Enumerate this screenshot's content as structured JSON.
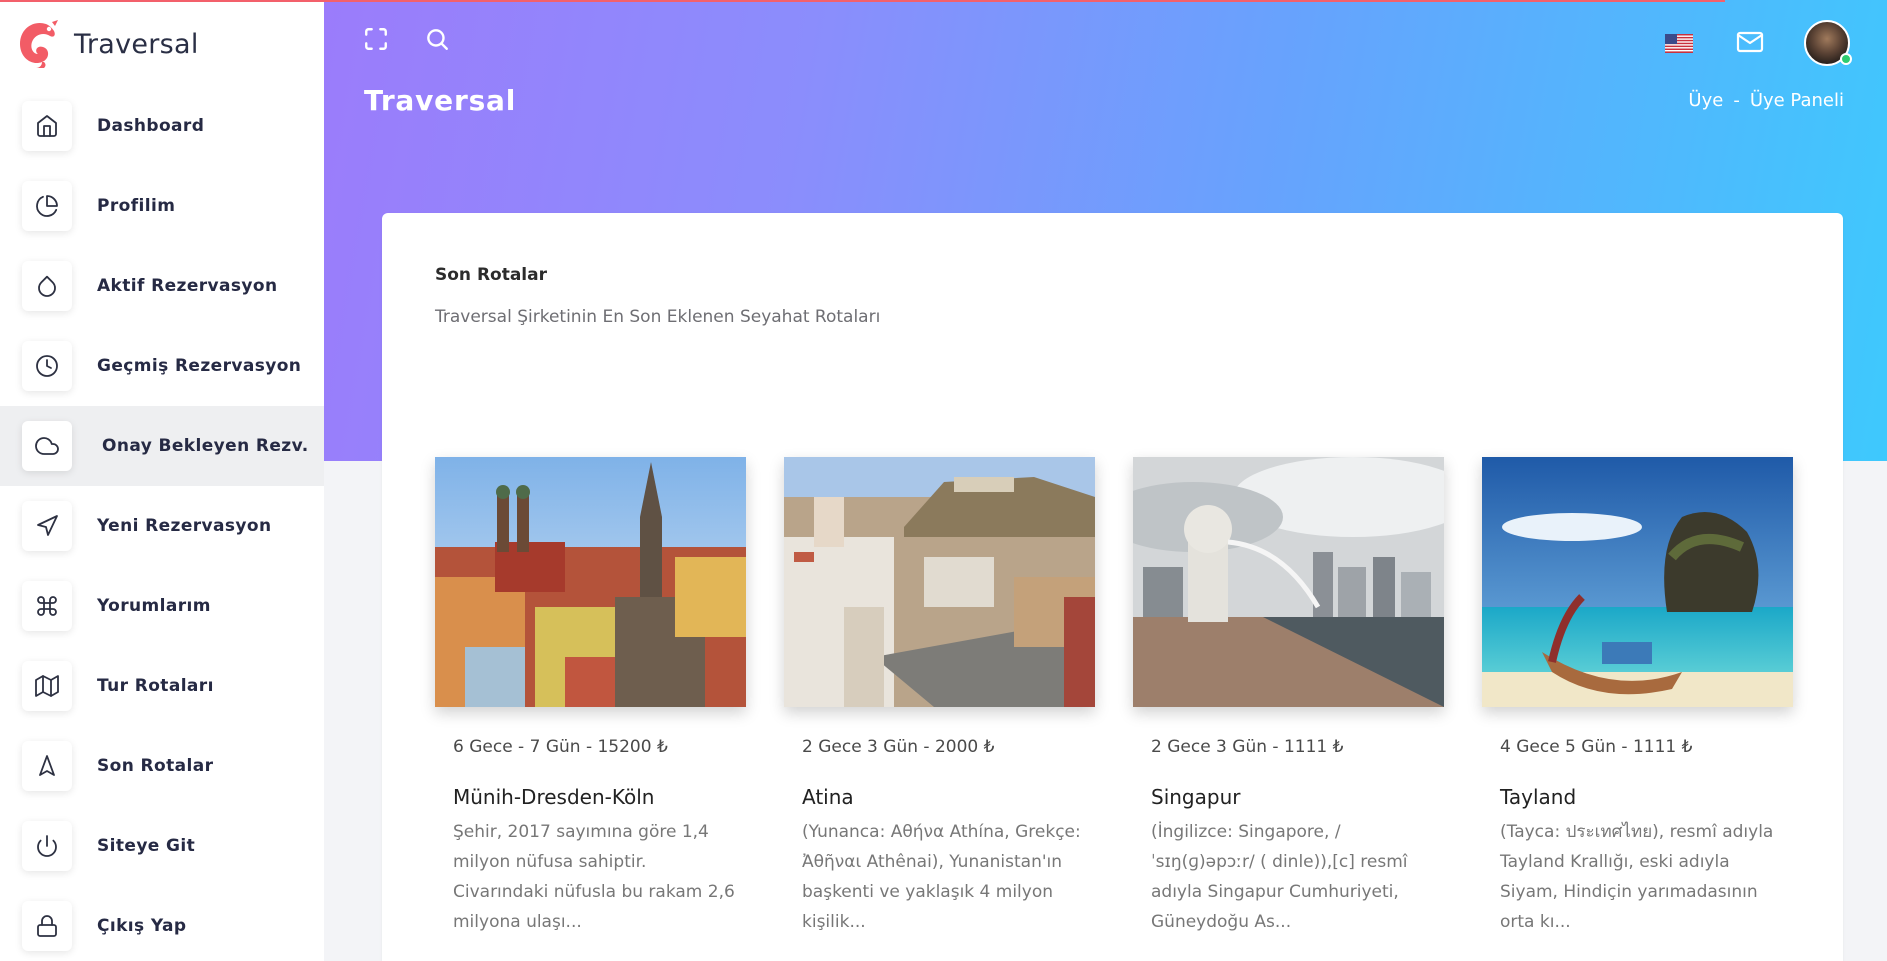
{
  "app": {
    "name": "Traversal"
  },
  "sidebar": {
    "items": [
      {
        "label": "Dashboard",
        "icon": "home-icon"
      },
      {
        "label": "Profilim",
        "icon": "pie-chart-icon"
      },
      {
        "label": "Aktif Rezervasyon",
        "icon": "droplet-icon"
      },
      {
        "label": "Geçmiş Rezervasyon",
        "icon": "clock-icon"
      },
      {
        "label": "Onay Bekleyen Rezv.",
        "icon": "cloud-icon",
        "active": true
      },
      {
        "label": "Yeni Rezervasyon",
        "icon": "navigation-icon"
      },
      {
        "label": "Yorumlarım",
        "icon": "command-icon"
      },
      {
        "label": "Tur Rotaları",
        "icon": "map-icon"
      },
      {
        "label": "Son Rotalar",
        "icon": "navigation-2-icon"
      },
      {
        "label": "Siteye Git",
        "icon": "power-icon"
      },
      {
        "label": "Çıkış Yap",
        "icon": "lock-icon"
      }
    ]
  },
  "header": {
    "title": "Traversal",
    "breadcrumb": {
      "first": "Üye",
      "separator": "-",
      "second": "Üye Paneli"
    },
    "icons": [
      "fullscreen-icon",
      "search-icon",
      "us-flag-icon",
      "mail-icon",
      "avatar"
    ]
  },
  "main": {
    "title": "Son Rotalar",
    "subtitle": "Traversal Şirketinin En Son Eklenen Seyahat Rotaları",
    "routes": [
      {
        "meta": "6 Gece - 7 Gün - 15200 ₺",
        "name": "Münih-Dresden-Köln",
        "desc": "Şehir, 2017 sayımına göre 1,4 milyon nüfusa sahiptir. Civarındaki nüfusla bu rakam 2,6 milyona ulaşı..."
      },
      {
        "meta": "2 Gece 3 Gün - 2000 ₺",
        "name": "Atina",
        "desc": "(Yunanca: Αθήνα Athína, Grekçe: Ἀθῆναι Athênai), Yunanistan'ın başkenti ve yaklaşık 4 milyon kişilik..."
      },
      {
        "meta": "2 Gece 3 Gün - 1111 ₺",
        "name": "Singapur",
        "desc": "(İngilizce: Singapore, / ˈsɪŋ(ɡ)əpɔːr/ ( dinle)),[c] resmî adıyla Singapur Cumhuriyeti, Güneydoğu As..."
      },
      {
        "meta": "4 Gece 5 Gün - 1111 ₺",
        "name": "Tayland",
        "desc": "(Tayca: ประเทศไทย), resmî adıyla Tayland Krallığı, eski adıyla Siyam, Hindiçin yarımadasının orta kı..."
      }
    ]
  },
  "colors": {
    "gradient_start": "#9b7cfb",
    "gradient_end": "#3ec9fd",
    "top_line": "#f3606b",
    "logo": "#f25c66",
    "online": "#2ecc71"
  }
}
